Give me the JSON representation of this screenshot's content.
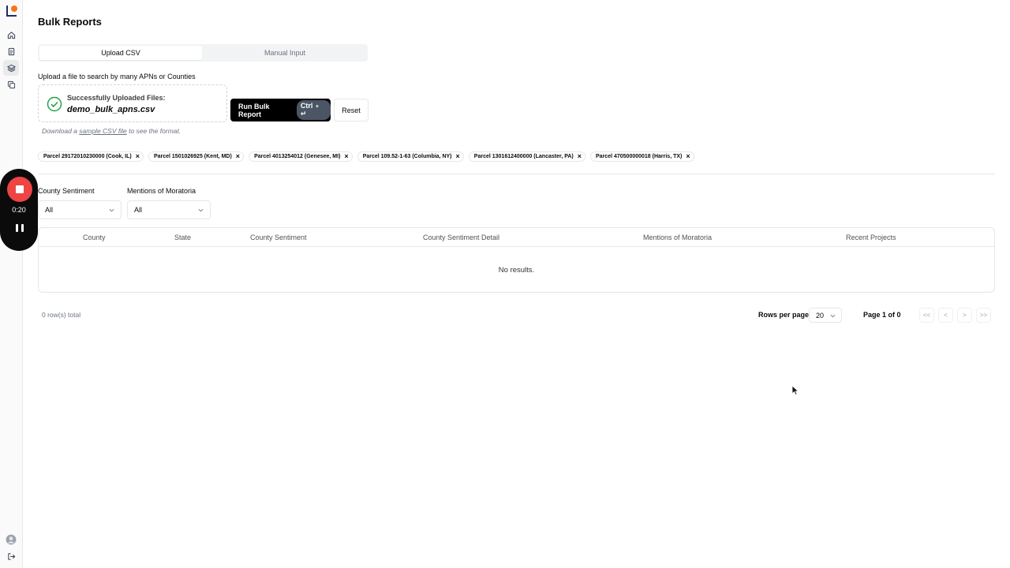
{
  "page": {
    "title": "Bulk Reports"
  },
  "tabs": [
    {
      "label": "Upload CSV",
      "active": true
    },
    {
      "label": "Manual Input",
      "active": false
    }
  ],
  "upload": {
    "label": "Upload a file to search by many APNs or Counties",
    "status_label": "Successfully Uploaded Files:",
    "file_name": "demo_bulk_apns.csv",
    "sample_prefix": "Download a ",
    "sample_link": "sample CSV file",
    "sample_suffix": " to see the format."
  },
  "actions": {
    "run_label": "Run Bulk Report",
    "run_kbd": "Ctrl",
    "run_kbd_plus": "+",
    "run_kbd_enter": "↵",
    "reset_label": "Reset"
  },
  "chips": [
    "Parcel 29172010230000 (Cook, IL)",
    "Parcel 1501026925 (Kent, MD)",
    "Parcel 4013254012 (Genesee, MI)",
    "Parcel 109.52-1-63 (Columbia, NY)",
    "Parcel 1301612400000 (Lancaster, PA)",
    "Parcel 470500000018 (Harris, TX)"
  ],
  "filters": {
    "sentiment": {
      "label": "County Sentiment",
      "value": "All"
    },
    "moratoria": {
      "label": "Mentions of Moratoria",
      "value": "All"
    }
  },
  "table": {
    "columns": [
      "County",
      "State",
      "County Sentiment",
      "County Sentiment Detail",
      "Mentions of Moratoria",
      "Recent Projects"
    ],
    "empty_text": "No results."
  },
  "pagination": {
    "row_count": "0 row(s) total",
    "rows_per_page_label": "Rows per page",
    "rows_per_page": "20",
    "page_info": "Page 1 of 0",
    "first": "<<",
    "prev": "<",
    "next": ">",
    "last": ">>"
  },
  "recorder": {
    "time": "0:20"
  },
  "colors": {
    "accent": "#000000",
    "success": "#22a34a",
    "record": "#ef4444",
    "logo_orange": "#f97316"
  },
  "icons": [
    "logo-icon",
    "home-icon",
    "document-icon",
    "layers-icon",
    "copy-icon",
    "user-avatar-icon",
    "logout-icon",
    "check-circle-icon",
    "close-icon",
    "chevron-down-icon",
    "stop-icon",
    "pause-icon",
    "cursor-icon"
  ]
}
